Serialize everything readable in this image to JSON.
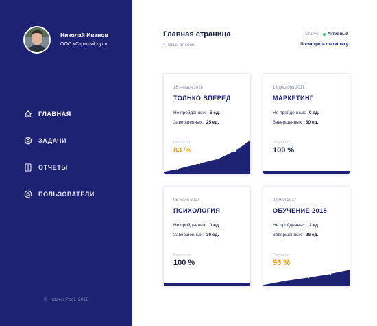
{
  "sidebar": {
    "user_name": "Николай Иванов",
    "company": "ООО «Скрытый пул»",
    "items": [
      {
        "label": "ГЛАВНАЯ",
        "icon": "home-icon",
        "active": true
      },
      {
        "label": "ЗАДАЧИ",
        "icon": "gear-icon",
        "active": false
      },
      {
        "label": "ОТЧЕТЫ",
        "icon": "document-icon",
        "active": false
      },
      {
        "label": "ПОЛЬЗОВАТЕЛИ",
        "icon": "at-sign-icon",
        "active": false
      }
    ],
    "footer": "© Hidden Pool, 2018"
  },
  "header": {
    "title": "Главная страница",
    "subtitle": "4 новых отчетов",
    "status_label": "Статус:",
    "status_value": "Активный",
    "stats_link": "Посмотреть статистику"
  },
  "cards": [
    {
      "date": "18 января 2018",
      "title": "ТОЛЬКО ВПЕРЕД",
      "row1_label": "Не пройденных:",
      "row1_value": "5 ед.",
      "row2_label": "Завершенных:",
      "row2_value": "25 ед.",
      "result_label": "Результат",
      "result": "83 %",
      "result_color": "orange",
      "progress": 0.83
    },
    {
      "date": "13 декабря 2017",
      "title": "МАРКЕТИНГ",
      "row1_label": "Не пройденных:",
      "row1_value": "0 ед.",
      "row2_label": "Завершенных:",
      "row2_value": "30 ед.",
      "result_label": "Результат",
      "result": "100 %",
      "result_color": "dark",
      "progress": 1.0
    },
    {
      "date": "05 июля 2017",
      "title": "ПСИХОЛОГИЯ",
      "row1_label": "Не пройденных:",
      "row1_value": "0 ед.",
      "row2_label": "Завершенных:",
      "row2_value": "30 ед.",
      "result_label": "Результат",
      "result": "100 %",
      "result_color": "dark",
      "progress": 1.0
    },
    {
      "date": "28 мая 2017",
      "title": "ОБУЧЕНИЕ 2018",
      "row1_label": "Не пройденных:",
      "row1_value": "2 ед.",
      "row2_label": "Завершенных:",
      "row2_value": "28 ед.",
      "result_label": "Результат",
      "result": "93 %",
      "result_color": "orange",
      "progress": 0.93
    }
  ],
  "colors": {
    "sidebar": "#1d2272",
    "accent": "#1d2272",
    "orange": "#f39c12",
    "active_status": "#3ac47d"
  }
}
